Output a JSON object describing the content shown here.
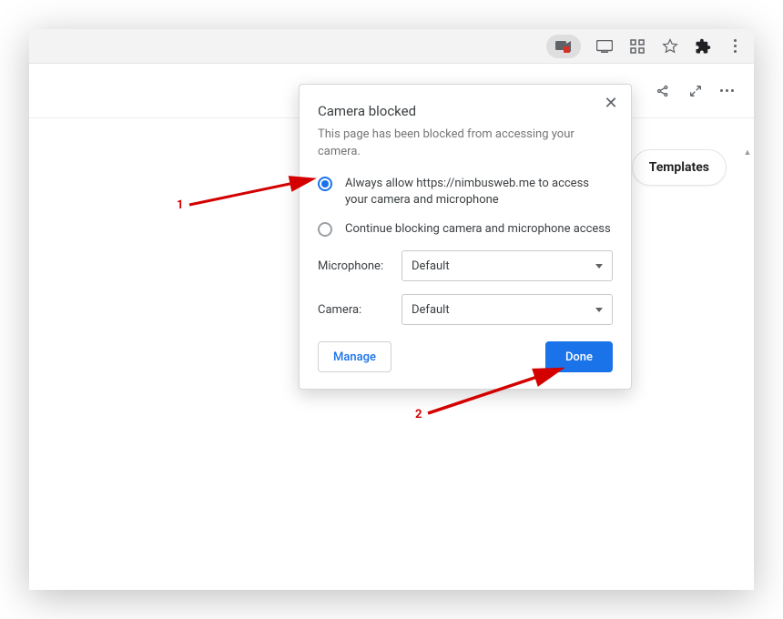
{
  "toolbar": {
    "camera_blocked_icon": "camera-blocked-icon",
    "cast_icon": "cast-icon",
    "grid_icon": "apps-grid-icon",
    "star_icon": "bookmark-star-icon",
    "extension_icon": "extensions-puzzle-icon",
    "menu_icon": "kebab-menu-icon"
  },
  "appbar": {
    "share_icon": "share-icon",
    "expand_icon": "expand-icon",
    "more_icon": "more-icon"
  },
  "templates_tab": {
    "label": "Templates"
  },
  "popup": {
    "title": "Camera blocked",
    "subtitle": "This page has been blocked from accessing your camera.",
    "options": [
      {
        "label": "Always allow https://nimbusweb.me to access your camera and microphone",
        "selected": true
      },
      {
        "label": "Continue blocking camera and microphone access",
        "selected": false
      }
    ],
    "devices": [
      {
        "label": "Microphone:",
        "value": "Default"
      },
      {
        "label": "Camera:",
        "value": "Default"
      }
    ],
    "manage_label": "Manage",
    "done_label": "Done"
  },
  "annotations": {
    "one": "1",
    "two": "2"
  }
}
